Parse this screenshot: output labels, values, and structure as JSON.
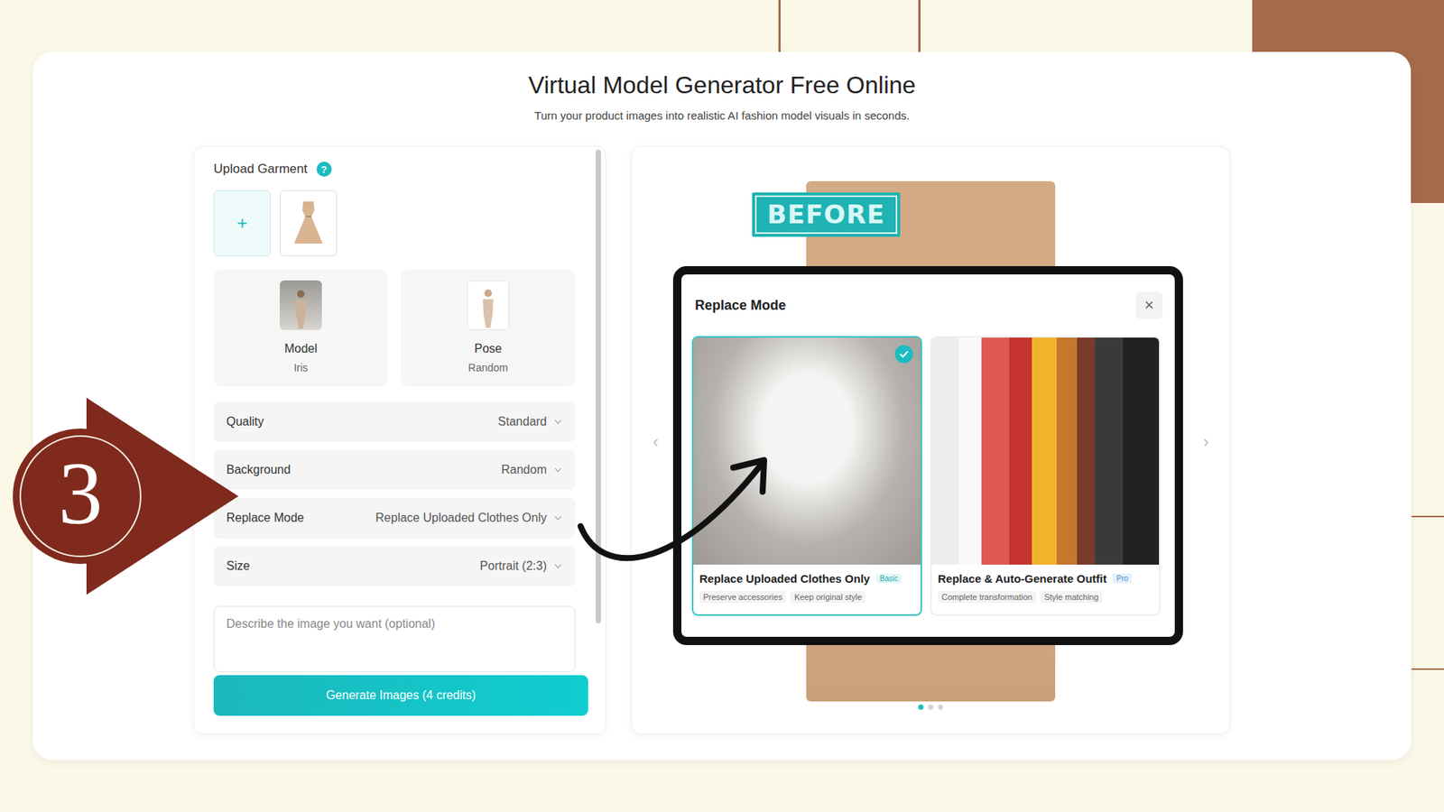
{
  "page": {
    "title": "Virtual Model Generator Free Online",
    "subtitle": "Turn your product images into realistic AI fashion model visuals in seconds."
  },
  "step": {
    "number": "3"
  },
  "upload": {
    "label": "Upload Garment",
    "help_icon": "?",
    "add_icon": "+"
  },
  "selectors": [
    {
      "label": "Model",
      "value": "Iris"
    },
    {
      "label": "Pose",
      "value": "Random"
    }
  ],
  "settings": [
    {
      "label": "Quality",
      "value": "Standard"
    },
    {
      "label": "Background",
      "value": "Random"
    },
    {
      "label": "Replace Mode",
      "value": "Replace Uploaded Clothes Only"
    },
    {
      "label": "Size",
      "value": "Portrait (2:3)"
    }
  ],
  "prompt": {
    "placeholder": "Describe the image you want (optional)"
  },
  "generate_button": "Generate Images (4 credits)",
  "preview": {
    "badge": "BEFORE",
    "dots": [
      {
        "selected": true
      },
      {
        "selected": false
      },
      {
        "selected": false
      }
    ]
  },
  "modal": {
    "title": "Replace Mode",
    "close": "×",
    "prev": "‹",
    "next": "›",
    "options": [
      {
        "title": "Replace Uploaded Clothes Only",
        "badge": "Basic",
        "tags": [
          "Preserve accessories",
          "Keep original style"
        ],
        "selected": true
      },
      {
        "title": "Replace & Auto-Generate Outfit",
        "badge": "Pro",
        "tags": [
          "Complete transformation",
          "Style matching"
        ],
        "selected": false
      }
    ]
  }
}
